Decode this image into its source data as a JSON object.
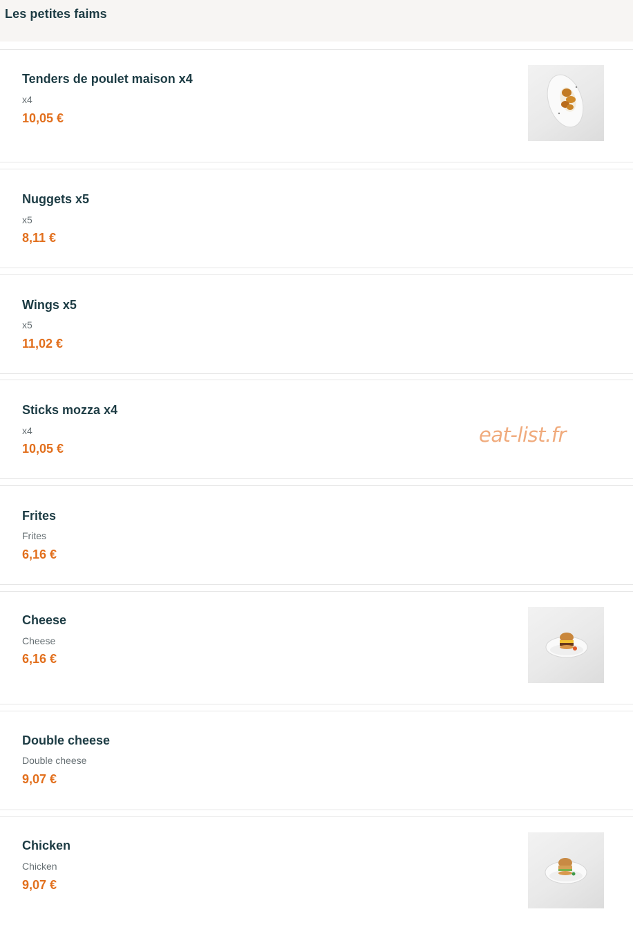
{
  "section": {
    "title": "Les petites faims"
  },
  "items": [
    {
      "name": "Tenders de poulet maison x4",
      "description": "x4",
      "price": "10,05 €",
      "photo": "plate-of-chicken-tenders"
    },
    {
      "name": "Nuggets x5",
      "description": "x5",
      "price": "8,11 €"
    },
    {
      "name": "Wings x5",
      "description": "x5",
      "price": "11,02 €"
    },
    {
      "name": "Sticks mozza x4",
      "description": "x4",
      "price": "10,05 €"
    },
    {
      "name": "Frites",
      "description": "Frites",
      "price": "6,16 €"
    },
    {
      "name": "Cheese",
      "description": "Cheese",
      "price": "6,16 €",
      "photo": "plate-with-cheeseburger"
    },
    {
      "name": "Double cheese",
      "description": "Double cheese",
      "price": "9,07 €"
    },
    {
      "name": "Chicken",
      "description": "Chicken",
      "price": "9,07 €",
      "photo": "plate-with-chicken-burger"
    }
  ],
  "watermark": "eat-list.fr",
  "colors": {
    "header_bg": "#f7f5f3",
    "title": "#1d3c44",
    "price": "#e2701e",
    "description": "#666f73",
    "watermark": "#f0ab7d"
  }
}
